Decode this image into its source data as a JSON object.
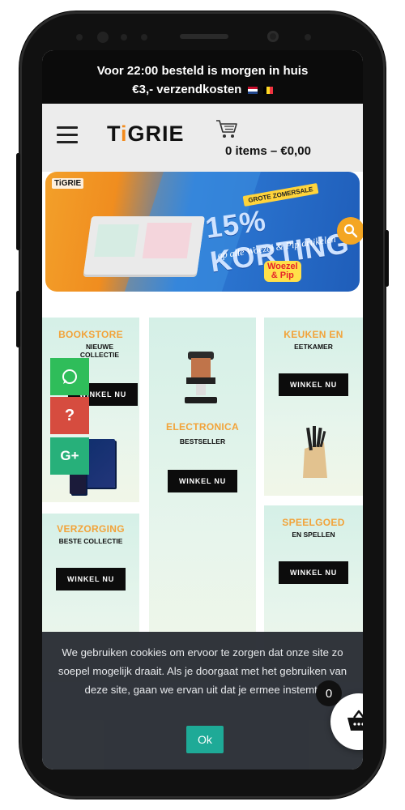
{
  "announcement": {
    "line1": "Voor 22:00 besteld is morgen in huis",
    "line2": "€3,- verzendkosten"
  },
  "header": {
    "logo_main": "T",
    "logo_accent": "i",
    "logo_rest": "GRIE",
    "cart_summary": "0 items – €0,00"
  },
  "banner": {
    "logo": "TiGRIE",
    "tag": "GROTE ZOMERSALE",
    "headline": "15% KORTING",
    "sub": "op alle Woezel & Pip artikelen",
    "brand_line1": "Woezel",
    "brand_line2": "& Pip"
  },
  "categories": [
    {
      "title": "BOOKSTORE",
      "sub": "NIEUWE COLLECTIE",
      "button": "WINKEL NU"
    },
    {
      "title": "ELECTRONICA",
      "sub": "BESTSELLER",
      "button": "WINKEL NU"
    },
    {
      "title": "KEUKEN EN",
      "sub": "EETKAMER",
      "button": "WINKEL NU"
    },
    {
      "title": "VERZORGING",
      "sub": "BESTE COLLECTIE",
      "button": "WINKEL NU"
    },
    {
      "title": "SPEELGOED",
      "sub": "EN SPELLEN",
      "button": "WINKEL NU"
    }
  ],
  "social": {
    "help": "?",
    "gplus": "G+"
  },
  "cookie": {
    "text": "We gebruiken cookies om ervoor te zorgen dat onze site zo soepel mogelijk draait. Als je doorgaat met het gebruiken van deze site, gaan we ervan uit dat je ermee instemt.",
    "button": "Ok"
  },
  "floating_cart": {
    "count": "0"
  },
  "colors": {
    "accent": "#f2a33a",
    "cookie_button": "#17a894",
    "whatsapp": "#2fbd5a",
    "help": "#d64c3f"
  }
}
